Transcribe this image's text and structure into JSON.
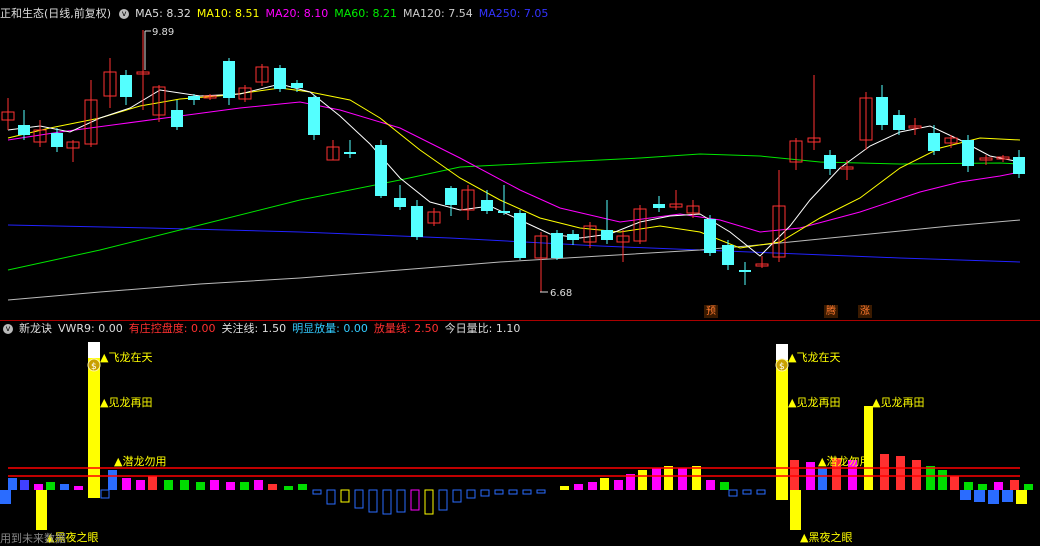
{
  "main_header": {
    "title": "正和生态(日线,前复权)",
    "ma5_label": "MA5:",
    "ma5": "8.32",
    "ma10_label": "MA10:",
    "ma10": "8.51",
    "ma20_label": "MA20:",
    "ma20": "8.10",
    "ma60_label": "MA60:",
    "ma60": "8.21",
    "ma120_label": "MA120:",
    "ma120": "7.54",
    "ma250_label": "MA250:",
    "ma250": "7.05"
  },
  "main_annotations": {
    "high_price": "9.89",
    "low_price": "6.68",
    "tag_yu": "预",
    "tag_teng": "腾",
    "tag_zhang": "涨"
  },
  "indicator_header": {
    "name": "新龙诀",
    "vwr9_label": "VWR9:",
    "vwr9": "0.00",
    "youzhuang_label": "有庄控盘度:",
    "youzhuang": "0.00",
    "guanzhu_label": "关注线:",
    "guanzhu": "1.50",
    "mingxian_label": "明显放量:",
    "mingxian": "0.00",
    "fangliang_label": "放量线:",
    "fangliang": "2.50",
    "jinri_label": "今日量比:",
    "jinri": "1.10"
  },
  "indicator_signals": {
    "fly": "▲飞龙在天",
    "see": "▲见龙再田",
    "hidden": "▲潜龙勿用",
    "eye": "▲黑夜之眼",
    "coin": "$"
  },
  "footer_text": "用到未来数据",
  "colors": {
    "up": "#ff3232",
    "down": "#54ffff",
    "ma5": "#ffffff",
    "ma10": "#ffff00",
    "ma20": "#ff00ff",
    "ma60": "#00e600",
    "ma120": "#bbbbbb",
    "ma250": "#2222ff",
    "signal_yellow": "#ffff00",
    "ref_line": "#ff0000"
  }
}
